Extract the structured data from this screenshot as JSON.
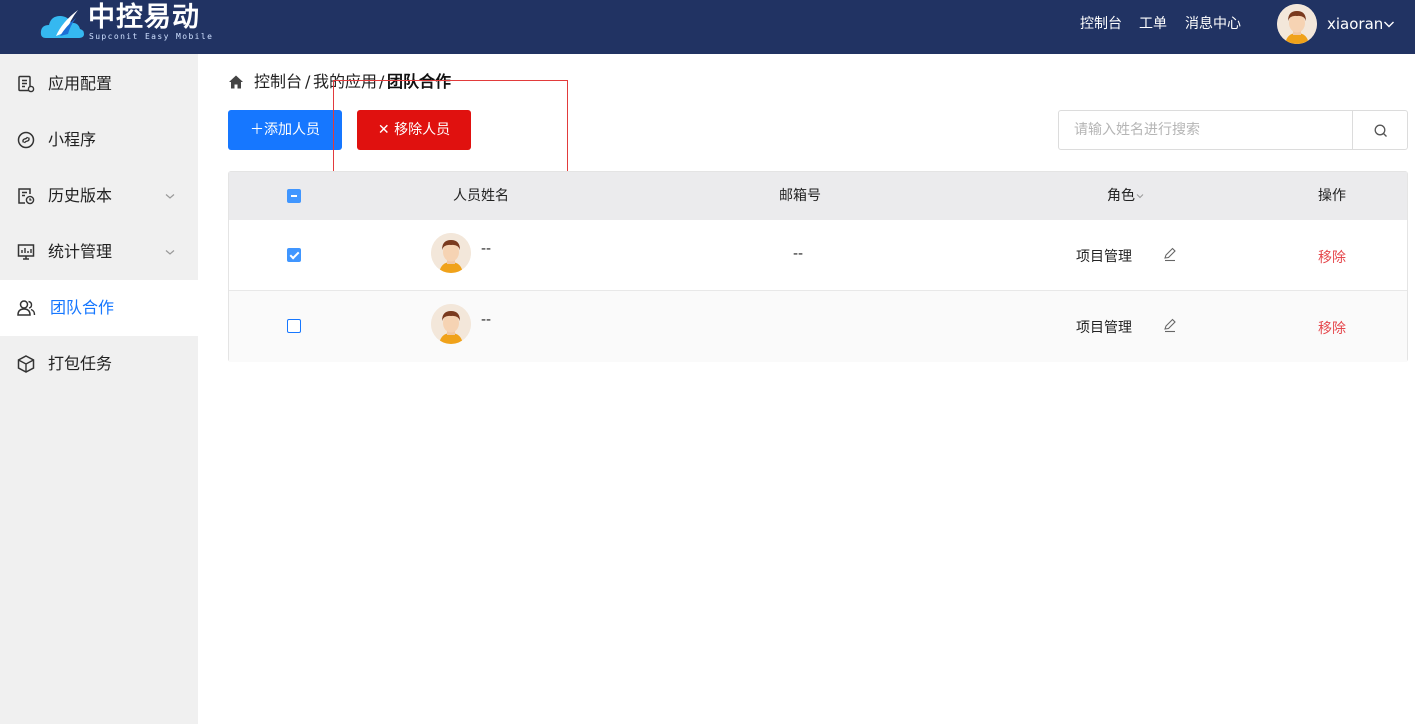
{
  "header": {
    "logo_title": "中控易动",
    "logo_subtitle": "Supconit Easy Mobile",
    "nav": [
      "控制台",
      "工单",
      "消息中心"
    ],
    "user": {
      "name": "xiaoran"
    },
    "bg_color": "#213363"
  },
  "sidebar": {
    "items": [
      {
        "label": "应用配置",
        "icon": "app-config-icon"
      },
      {
        "label": "小程序",
        "icon": "mini-program-icon"
      },
      {
        "label": "历史版本",
        "icon": "history-icon",
        "has_submenu": true
      },
      {
        "label": "统计管理",
        "icon": "statistics-icon",
        "has_submenu": true
      },
      {
        "label": "团队合作",
        "icon": "team-icon",
        "active": true
      },
      {
        "label": "打包任务",
        "icon": "package-icon"
      }
    ],
    "active_color": "#1677ff"
  },
  "breadcrumb": {
    "items": [
      "控制台",
      "我的应用",
      "团队合作"
    ],
    "separator": "/"
  },
  "toolbar": {
    "add_label": "添加人员",
    "remove_label": "移除人员",
    "add_color": "#1677ff",
    "remove_color": "#e0110f"
  },
  "search": {
    "placeholder": "请输入姓名进行搜索",
    "value": ""
  },
  "table": {
    "columns": [
      "人员姓名",
      "邮箱号",
      "角色",
      "操作"
    ],
    "rows": [
      {
        "checked": true,
        "name": "--",
        "email": "--",
        "role": "项目管理",
        "action": "移除"
      },
      {
        "checked": false,
        "name": "--",
        "email": "",
        "role": "项目管理",
        "action": "移除"
      }
    ]
  }
}
